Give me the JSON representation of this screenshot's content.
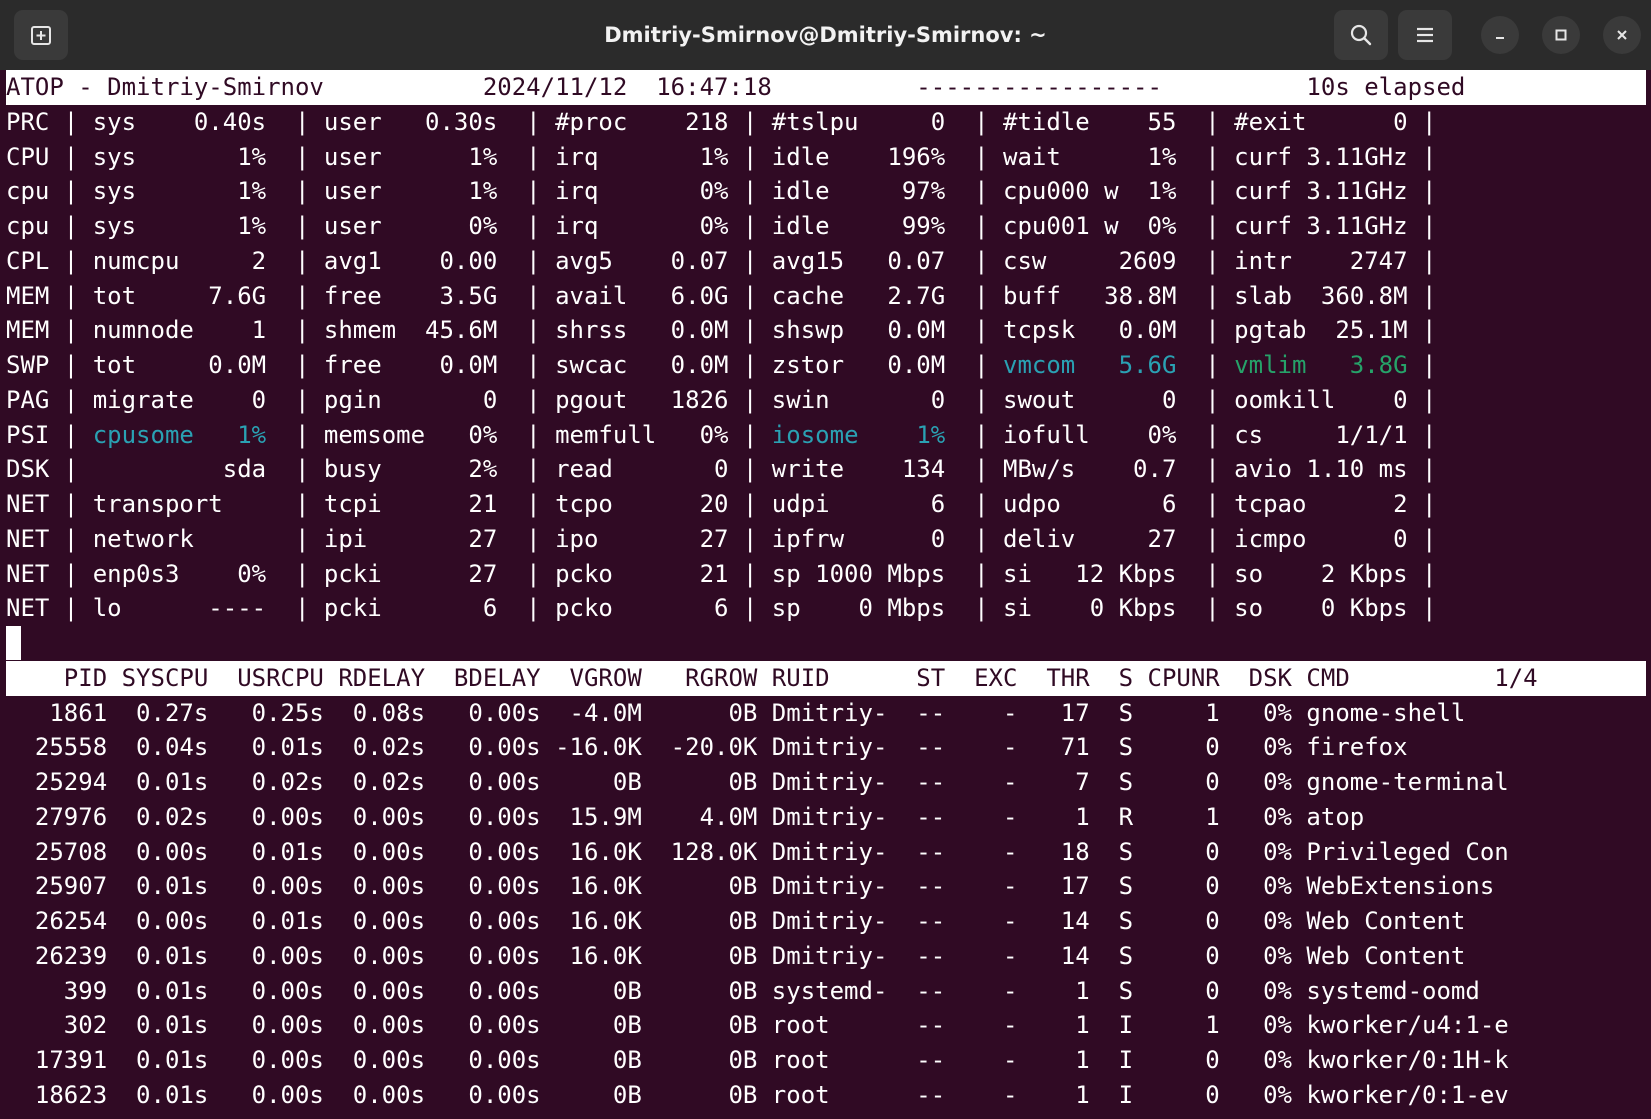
{
  "window": {
    "title": "Dmitriy-Smirnov@Dmitriy-Smirnov: ~"
  },
  "terminal": {
    "header": "ATOP - Dmitriy-Smirnov           2024/11/12  16:47:18          -----------------          10s elapsed",
    "system_lines": [
      [
        {
          "t": "PRC | sys    0.40s  | user   0.30s  | #proc    218 | #tslpu     0  | #tidle    55  | #exit      0 |"
        }
      ],
      [
        {
          "t": "CPU | sys       1%  | user      1%  | irq       1% | idle    196%  | wait      1%  | curf 3.11GHz |"
        }
      ],
      [
        {
          "t": "cpu | sys       1%  | user      1%  | irq       0% | idle     97%  | cpu000 w  1%  | curf 3.11GHz |"
        }
      ],
      [
        {
          "t": "cpu | sys       1%  | user      0%  | irq       0% | idle     99%  | cpu001 w  0%  | curf 3.11GHz |"
        }
      ],
      [
        {
          "t": "CPL | numcpu     2  | avg1    0.00  | avg5    0.07 | avg15   0.07  | csw     2609  | intr    2747 |"
        }
      ],
      [
        {
          "t": "MEM | tot     7.6G  | free    3.5G  | avail   6.0G | cache   2.7G  | buff   38.8M  | slab  360.8M |"
        }
      ],
      [
        {
          "t": "MEM | numnode    1  | shmem  45.6M  | shrss   0.0M | shswp   0.0M  | tcpsk   0.0M  | pgtab  25.1M |"
        }
      ],
      [
        {
          "t": "SWP | tot     0.0M  | free    0.0M  | swcac   0.0M | zstor   0.0M  | "
        },
        {
          "t": "vmcom   5.6G",
          "c": "cy"
        },
        {
          "t": "  | "
        },
        {
          "t": "vmlim   3.8G",
          "c": "gr"
        },
        {
          "t": " |"
        }
      ],
      [
        {
          "t": "PAG | migrate    0  | pgin       0  | pgout   1826 | swin       0  | swout      0  | oomkill    0 |"
        }
      ],
      [
        {
          "t": "PSI | "
        },
        {
          "t": "cpusome   1%",
          "c": "cy"
        },
        {
          "t": "  | memsome   0%  | memfull   0% | "
        },
        {
          "t": "iosome    1%",
          "c": "cy"
        },
        {
          "t": "  | iofull    0%  | cs     1/1/1 |"
        }
      ],
      [
        {
          "t": "DSK |          sda  | busy      2%  | read       0 | write    134  | MBw/s    0.7  | avio 1.10 ms |"
        }
      ],
      [
        {
          "t": "NET | transport     | tcpi      21  | tcpo      20 | udpi       6  | udpo       6  | tcpao      2 |"
        }
      ],
      [
        {
          "t": "NET | network       | ipi       27  | ipo       27 | ipfrw      0  | deliv     27  | icmpo      0 |"
        }
      ],
      [
        {
          "t": "NET | enp0s3    0%  | pcki      27  | pcko      21 | sp 1000 Mbps  | si   12 Kbps  | so    2 Kbps |"
        }
      ],
      [
        {
          "t": "NET | lo      ----  | pcki       6  | pcko       6 | sp    0 Mbps  | si    0 Kbps  | so    0 Kbps |"
        }
      ]
    ],
    "process_header": "    PID SYSCPU  USRCPU RDELAY  BDELAY  VGROW   RGROW RUID      ST  EXC  THR  S CPUNR  DSK CMD          1/4",
    "process_rows": [
      "   1861  0.27s   0.25s  0.08s   0.00s  -4.0M      0B Dmitriy-  --    -   17  S     1   0% gnome-shell",
      "  25558  0.04s   0.01s  0.02s   0.00s -16.0K  -20.0K Dmitriy-  --    -   71  S     0   0% firefox",
      "  25294  0.01s   0.02s  0.02s   0.00s     0B      0B Dmitriy-  --    -    7  S     0   0% gnome-terminal",
      "  27976  0.02s   0.00s  0.00s   0.00s  15.9M    4.0M Dmitriy-  --    -    1  R     1   0% atop",
      "  25708  0.00s   0.01s  0.00s   0.00s  16.0K  128.0K Dmitriy-  --    -   18  S     0   0% Privileged Con",
      "  25907  0.01s   0.00s  0.00s   0.00s  16.0K      0B Dmitriy-  --    -   17  S     0   0% WebExtensions",
      "  26254  0.00s   0.01s  0.00s   0.00s  16.0K      0B Dmitriy-  --    -   14  S     0   0% Web Content",
      "  26239  0.01s   0.00s  0.00s   0.00s  16.0K      0B Dmitriy-  --    -   14  S     0   0% Web Content",
      "    399  0.01s   0.00s  0.00s   0.00s     0B      0B systemd-  --    -    1  S     0   0% systemd-oomd",
      "    302  0.01s   0.00s  0.00s   0.00s     0B      0B root      --    -    1  I     1   0% kworker/u4:1-e",
      "  17391  0.01s   0.00s  0.00s   0.00s     0B      0B root      --    -    1  I     0   0% kworker/0:1H-k",
      "  18623  0.01s   0.00s  0.00s   0.00s     0B      0B root      --    -    1  I     0   0% kworker/0:1-ev"
    ]
  },
  "icons": {
    "new_tab": "new-tab-icon",
    "search": "search-icon",
    "menu": "hamburger-menu-icon",
    "minimize": "minimize-icon",
    "maximize": "maximize-icon",
    "close": "close-icon"
  },
  "colors": {
    "terminal_bg": "#300a24",
    "titlebar_bg": "#2b2b2b",
    "cyan": "#2aa1b3",
    "green": "#26a269"
  }
}
